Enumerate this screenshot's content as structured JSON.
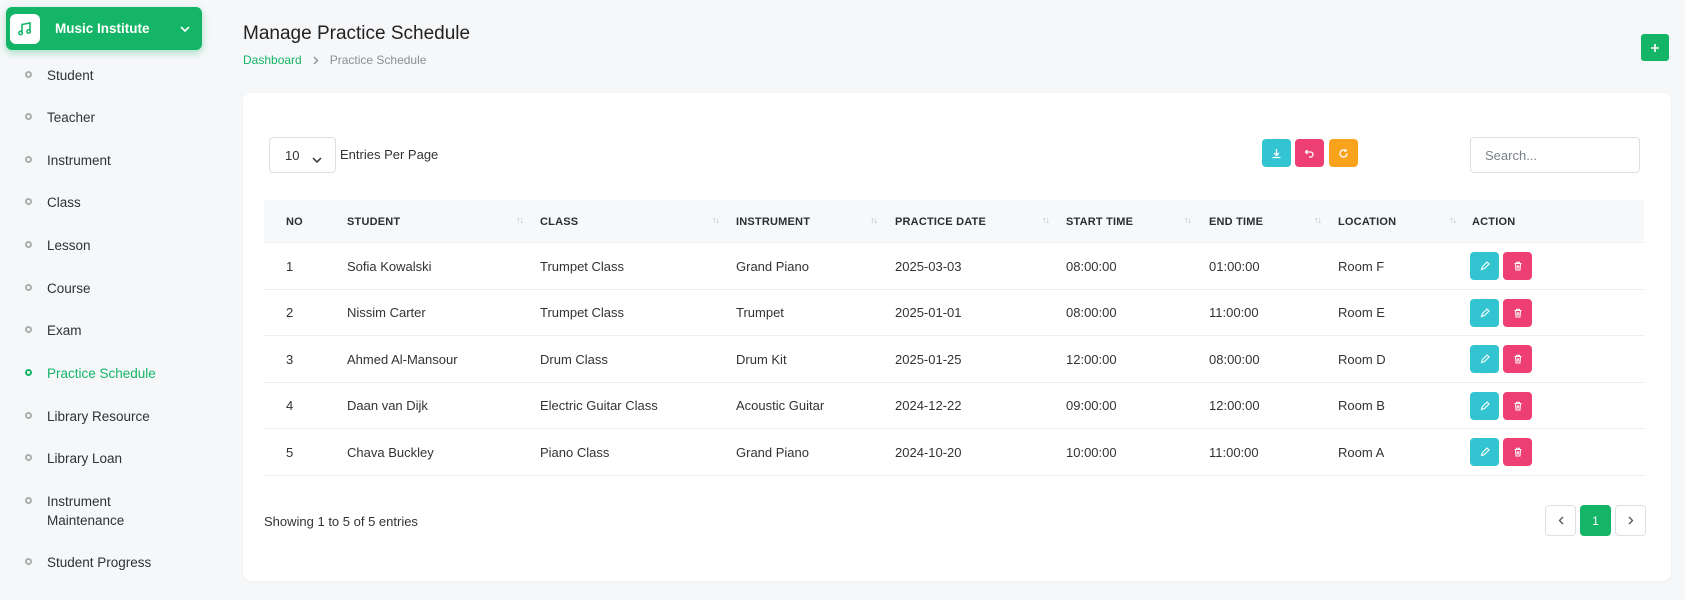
{
  "sidebar": {
    "brand": "Music Institute",
    "items": [
      {
        "label": "Student"
      },
      {
        "label": "Teacher"
      },
      {
        "label": "Instrument"
      },
      {
        "label": "Class"
      },
      {
        "label": "Lesson"
      },
      {
        "label": "Course"
      },
      {
        "label": "Exam"
      },
      {
        "label": "Practice Schedule",
        "active": true
      },
      {
        "label": "Library Resource"
      },
      {
        "label": "Library Loan"
      },
      {
        "label": "Instrument Maintenance"
      },
      {
        "label": "Student Progress"
      }
    ]
  },
  "header": {
    "title": "Manage Practice Schedule",
    "breadcrumb": {
      "home": "Dashboard",
      "current": "Practice Schedule"
    }
  },
  "toolbar": {
    "entries_value": "10",
    "entries_label": "Entries Per Page",
    "search_placeholder": "Search..."
  },
  "colors": {
    "accent": "#14b566",
    "info": "#33c4d1",
    "danger": "#ee3f73",
    "warning": "#f9a21b"
  },
  "table": {
    "columns": [
      "NO",
      "STUDENT",
      "CLASS",
      "INSTRUMENT",
      "PRACTICE DATE",
      "START TIME",
      "END TIME",
      "LOCATION",
      "ACTION"
    ],
    "rows": [
      [
        "1",
        "Sofia Kowalski",
        "Trumpet Class",
        "Grand Piano",
        "2025-03-03",
        "08:00:00",
        "01:00:00",
        "Room F"
      ],
      [
        "2",
        "Nissim Carter",
        "Trumpet Class",
        "Trumpet",
        "2025-01-01",
        "08:00:00",
        "11:00:00",
        "Room E"
      ],
      [
        "3",
        "Ahmed Al-Mansour",
        "Drum Class",
        "Drum Kit",
        "2025-01-25",
        "12:00:00",
        "08:00:00",
        "Room D"
      ],
      [
        "4",
        "Daan van Dijk",
        "Electric Guitar Class",
        "Acoustic Guitar",
        "2024-12-22",
        "09:00:00",
        "12:00:00",
        "Room B"
      ],
      [
        "5",
        "Chava Buckley",
        "Piano Class",
        "Grand Piano",
        "2024-10-20",
        "10:00:00",
        "11:00:00",
        "Room A"
      ]
    ]
  },
  "footer": {
    "showing": "Showing 1 to 5 of 5 entries",
    "current_page": "1"
  }
}
